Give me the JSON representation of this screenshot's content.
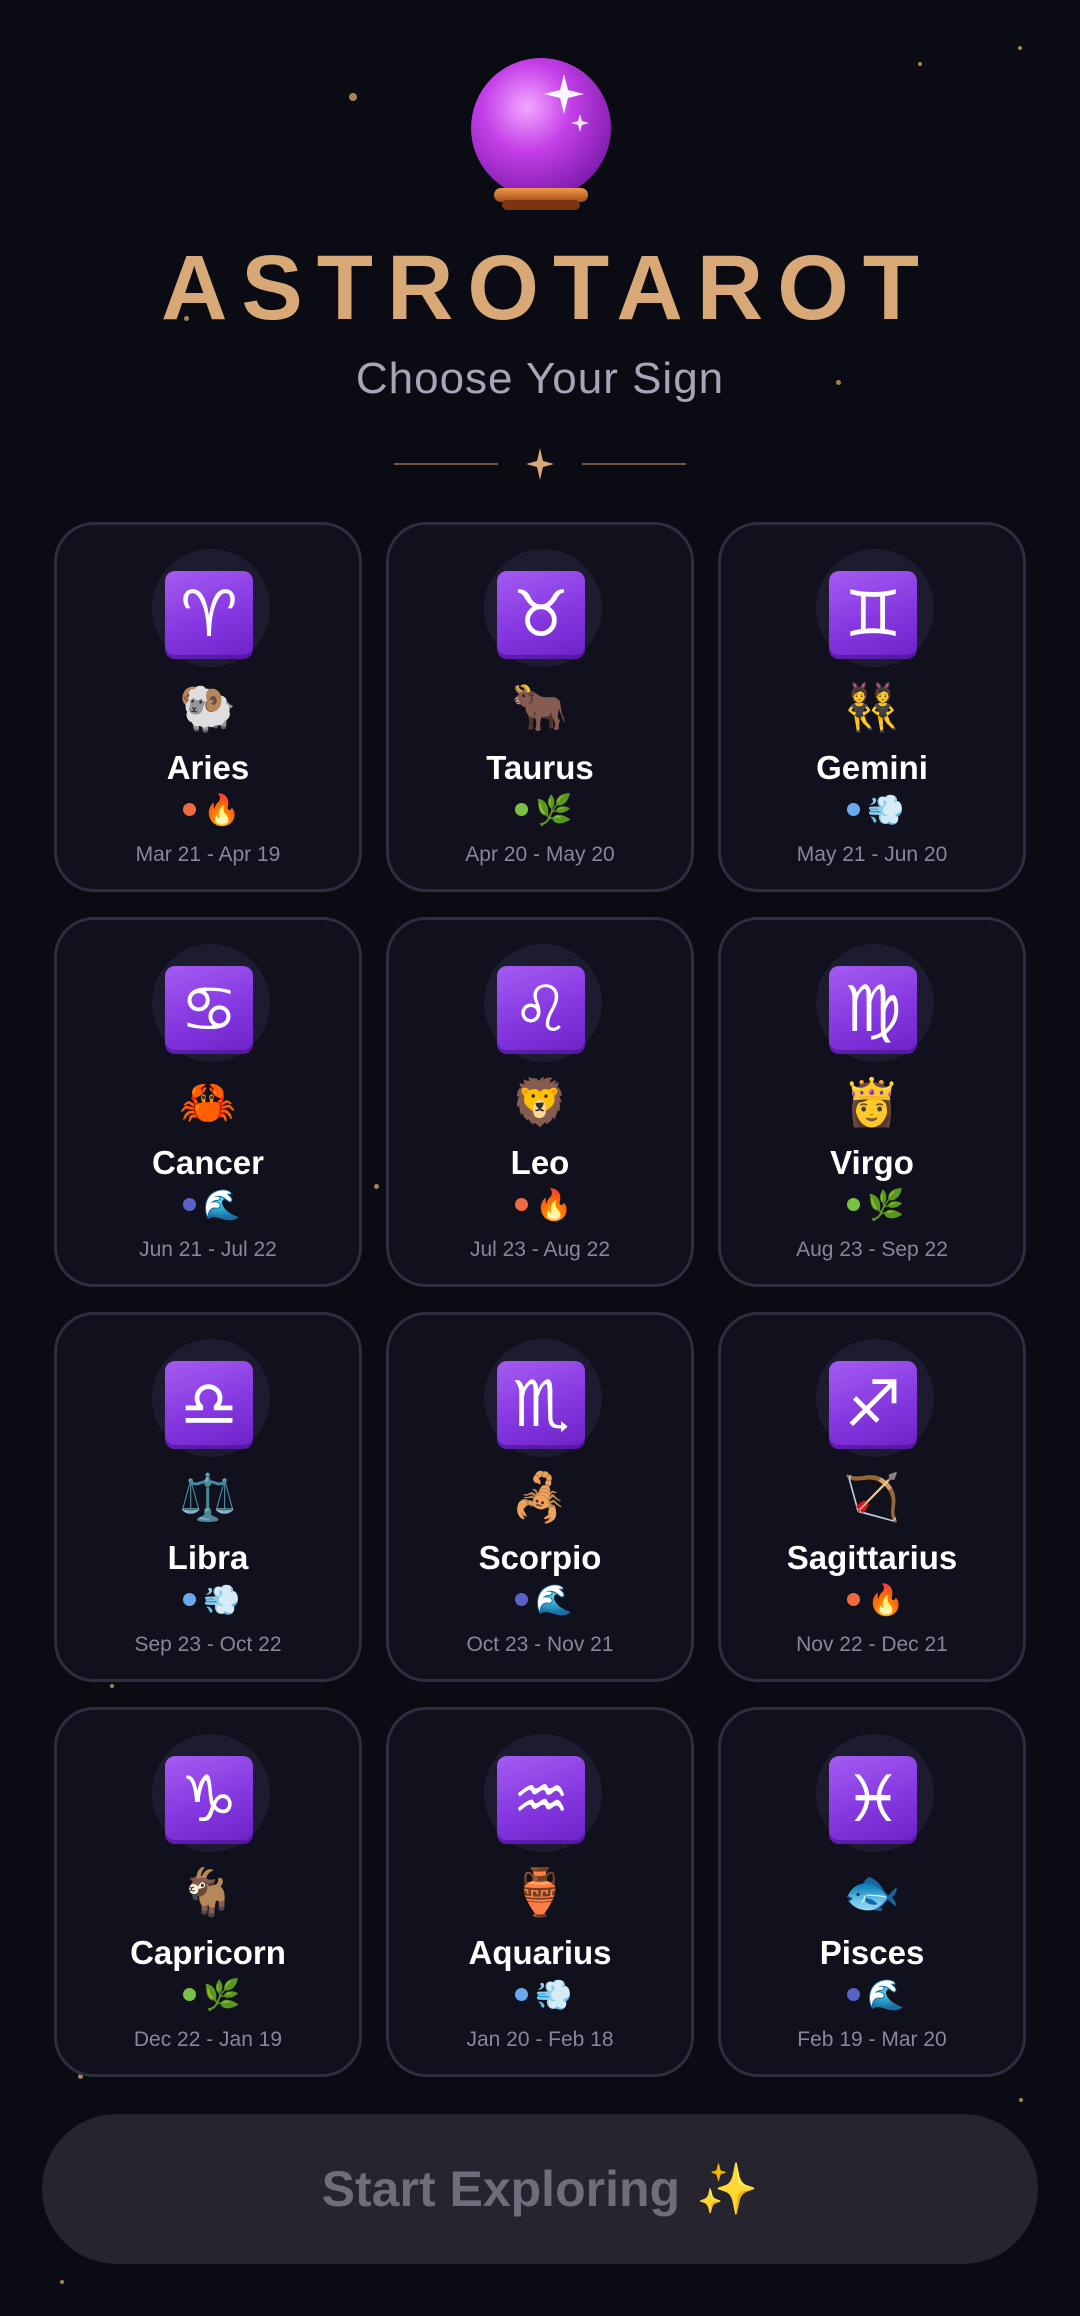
{
  "header": {
    "title": "ASTROTAROT",
    "subtitle": "Choose Your Sign"
  },
  "colors": {
    "background": "#0b0b14",
    "title": "#d8a877",
    "card_border": "#2e2e40",
    "sign_tile": "#8a3ce3",
    "fire_dot": "#f06a3f",
    "earth_dot": "#7bc043",
    "air_dot": "#6aa9f0",
    "water_dot": "#5a62c8"
  },
  "signs": [
    {
      "name": "Aries",
      "glyph": "♈",
      "animal": "🐏",
      "element": "fire",
      "element_icon": "🔥",
      "dates": "Mar 21 - Apr 19"
    },
    {
      "name": "Taurus",
      "glyph": "♉",
      "animal": "🐂",
      "element": "earth",
      "element_icon": "🌿",
      "dates": "Apr 20 - May 20"
    },
    {
      "name": "Gemini",
      "glyph": "♊",
      "animal": "👯",
      "element": "air",
      "element_icon": "💨",
      "dates": "May 21 - Jun 20"
    },
    {
      "name": "Cancer",
      "glyph": "♋",
      "animal": "🦀",
      "element": "water",
      "element_icon": "🌊",
      "dates": "Jun 21 - Jul 22"
    },
    {
      "name": "Leo",
      "glyph": "♌",
      "animal": "🦁",
      "element": "fire",
      "element_icon": "🔥",
      "dates": "Jul 23 - Aug 22"
    },
    {
      "name": "Virgo",
      "glyph": "♍",
      "animal": "👸",
      "element": "earth",
      "element_icon": "🌿",
      "dates": "Aug 23 - Sep 22"
    },
    {
      "name": "Libra",
      "glyph": "♎",
      "animal": "⚖️",
      "element": "air",
      "element_icon": "💨",
      "dates": "Sep 23 - Oct 22"
    },
    {
      "name": "Scorpio",
      "glyph": "♏",
      "animal": "🦂",
      "element": "water",
      "element_icon": "🌊",
      "dates": "Oct 23 - Nov 21"
    },
    {
      "name": "Sagittarius",
      "glyph": "♐",
      "animal": "🏹",
      "element": "fire",
      "element_icon": "🔥",
      "dates": "Nov 22 - Dec 21"
    },
    {
      "name": "Capricorn",
      "glyph": "♑",
      "animal": "🐐",
      "element": "earth",
      "element_icon": "🌿",
      "dates": "Dec 22 - Jan 19"
    },
    {
      "name": "Aquarius",
      "glyph": "♒",
      "animal": "🏺",
      "element": "air",
      "element_icon": "💨",
      "dates": "Jan 20 - Feb 18"
    },
    {
      "name": "Pisces",
      "glyph": "♓",
      "animal": "🐟",
      "element": "water",
      "element_icon": "🌊",
      "dates": "Feb 19 - Mar 20"
    }
  ],
  "cta": {
    "label": "Start Exploring",
    "icon": "✨"
  }
}
